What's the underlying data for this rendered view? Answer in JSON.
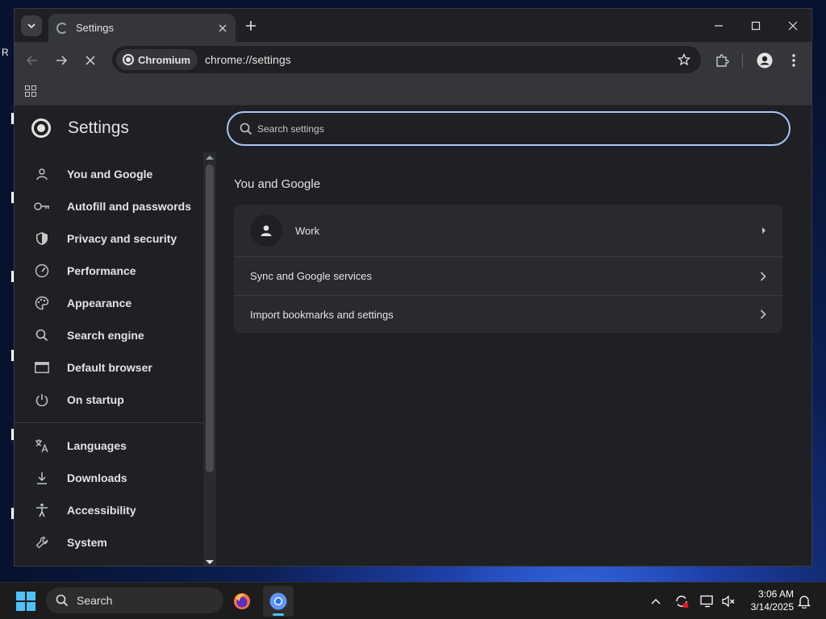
{
  "browser": {
    "tab": {
      "title": "Settings"
    },
    "omnibox": {
      "chip_label": "Chromium",
      "url": "chrome://settings"
    }
  },
  "settings": {
    "title": "Settings",
    "search": {
      "placeholder": "Search settings"
    },
    "nav": [
      {
        "label": "You and Google",
        "icon": "person-icon"
      },
      {
        "label": "Autofill and passwords",
        "icon": "key-icon"
      },
      {
        "label": "Privacy and security",
        "icon": "shield-icon"
      },
      {
        "label": "Performance",
        "icon": "speedometer-icon"
      },
      {
        "label": "Appearance",
        "icon": "palette-icon"
      },
      {
        "label": "Search engine",
        "icon": "search-icon"
      },
      {
        "label": "Default browser",
        "icon": "browser-window-icon"
      },
      {
        "label": "On startup",
        "icon": "power-icon"
      },
      {
        "label": "Languages",
        "icon": "translate-icon"
      },
      {
        "label": "Downloads",
        "icon": "download-icon"
      },
      {
        "label": "Accessibility",
        "icon": "accessibility-icon"
      },
      {
        "label": "System",
        "icon": "wrench-icon"
      }
    ],
    "section": {
      "title": "You and Google",
      "profile_name": "Work",
      "rows": [
        {
          "label": "Sync and Google services"
        },
        {
          "label": "Import bookmarks and settings"
        }
      ]
    }
  },
  "taskbar": {
    "search_label": "Search",
    "time": "3:06 AM",
    "date": "3/14/2025"
  },
  "colors": {
    "accent": "#a8c7fa",
    "windows_blue": "#4cc2ff"
  }
}
